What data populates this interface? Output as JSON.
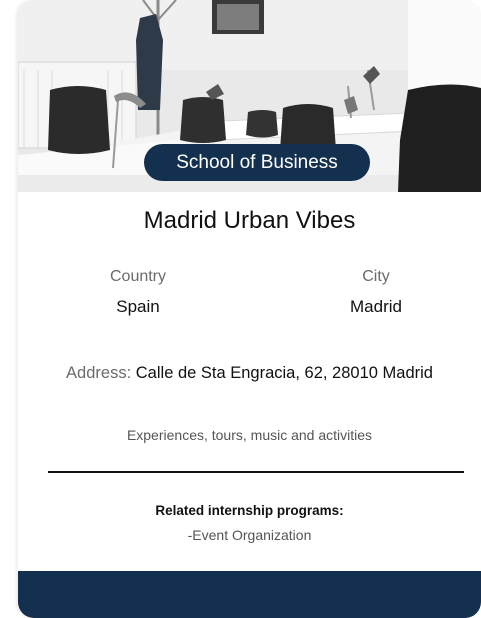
{
  "card": {
    "badge": "School of Business",
    "title": "Madrid Urban Vibes",
    "country_label": "Country",
    "country_value": "Spain",
    "city_label": "City",
    "city_value": "Madrid",
    "address_label": "Address:",
    "address_value": "Calle de Sta Engracia, 62, 28010 Madrid",
    "description": "Experiences, tours, music and activities",
    "related_heading": "Related internship programs:",
    "related_items": [
      "-Event Organization"
    ]
  },
  "colors": {
    "badge_bg": "#14304f",
    "footer_bg": "#14304f"
  },
  "image": {
    "subject": "office-room-photo"
  }
}
